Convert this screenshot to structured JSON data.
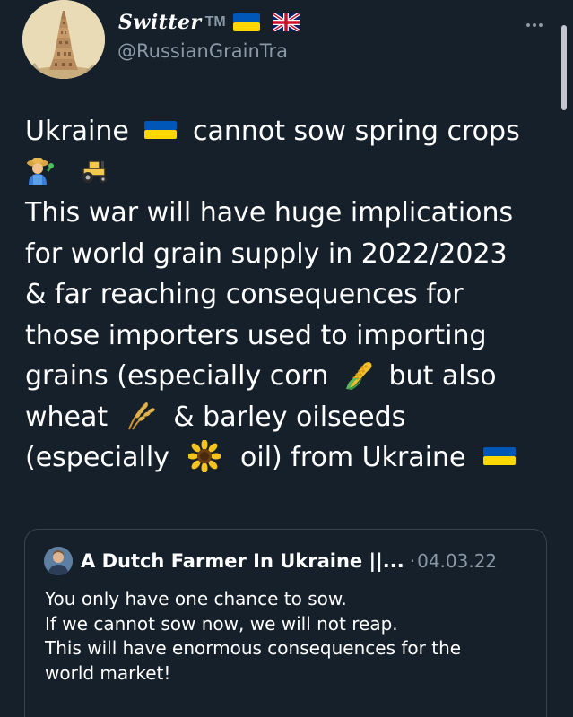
{
  "header": {
    "display_name": "Switter",
    "tm": "TM",
    "handle": "@RussianGrainTra",
    "more_label": "More"
  },
  "tweet": {
    "lines": [
      [
        "Ukraine ",
        "flag-ua-icon",
        " cannot sow spring crops"
      ],
      [
        "farmer-icon",
        " ",
        "tractor-icon"
      ],
      [
        "This war will have huge implications"
      ],
      [
        "for world grain supply in 2022/2023"
      ],
      [
        "& far reaching consequences for"
      ],
      [
        "those importers used to importing"
      ],
      [
        "grains (especially corn ",
        "corn-icon",
        " but also"
      ],
      [
        "wheat ",
        "wheat-icon",
        " & barley oilseeds"
      ],
      [
        "(especially ",
        "sunflower-icon",
        " oil) from Ukraine ",
        "flag-ua-icon"
      ]
    ],
    "line_text": {
      "l1a": "Ukraine",
      "l1b": "cannot sow spring crops",
      "l3": "This war will have huge implications",
      "l4": "for world grain supply in 2022/2023",
      "l5": "& far reaching consequences for",
      "l6": "those importers used to importing",
      "l7a": "grains (especially corn",
      "l7b": "but also",
      "l8a": "wheat",
      "l8b": "& barley oilseeds",
      "l9a": "(especially",
      "l9b": "oil) from Ukraine"
    }
  },
  "quote": {
    "author": "A Dutch Farmer In Ukraine ||...",
    "separator": "·",
    "date": "04.03.22",
    "lines": [
      "You only have one chance to sow.",
      "If we cannot sow now, we will not reap.",
      "This will have enormous consequences for the",
      "world market!"
    ]
  },
  "colors": {
    "background": "#15202b",
    "secondary_text": "#8b98a5",
    "border": "#38444d",
    "flag_blue": "#0057b7",
    "flag_yellow": "#ffd700"
  }
}
